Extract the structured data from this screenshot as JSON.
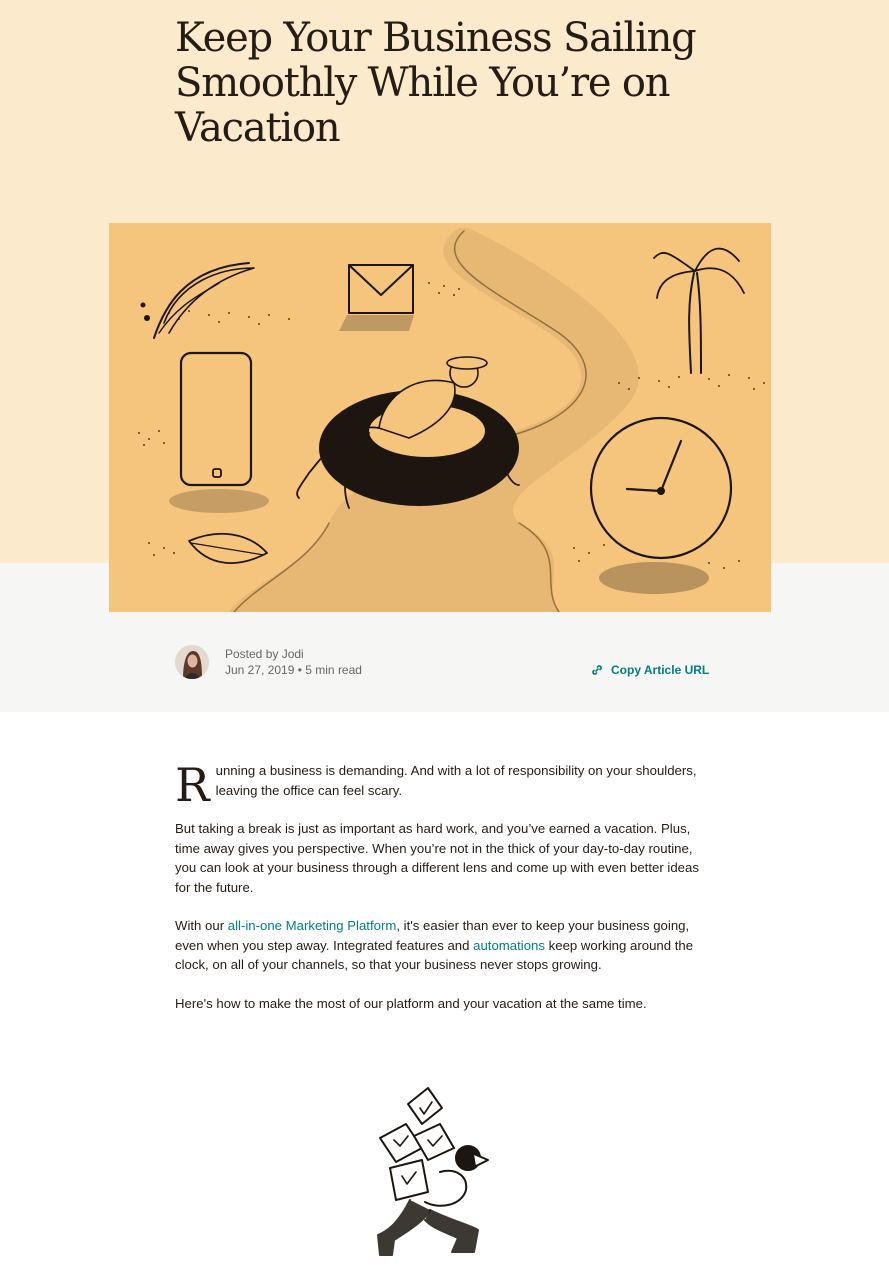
{
  "article": {
    "title": "Keep Your Business Sailing Smoothly While You’re on Vacation",
    "meta": {
      "posted_by": "Posted by Jodi",
      "date_read": "Jun 27, 2019 • 5 min read",
      "copy_url_label": "Copy Article URL",
      "link_icon": "link-icon",
      "avatar": "author-avatar"
    },
    "intro": {
      "dropcap": "R",
      "rest": "unning a business is demanding. And with a lot of responsibility on your shoulders, leaving the office can feel scary."
    },
    "p2": "But taking a break is just as important as hard work, and you’ve earned a vacation. Plus, time away gives you perspective. When you’re not in the thick of your day-to-day routine, you can look at your business through a different lens and come up with even better ideas for the future.",
    "p3": {
      "before_link1": "With our ",
      "link1": "all-in-one Marketing Platform",
      "between": ", it's easier than ever to keep your business going, even when you step away. Integrated features and ",
      "link2": "automations",
      "after": " keep working around the clock, on all of your channels, so that your business never stops growing."
    },
    "p4": "Here's how to make the most of our platform and your vacation at the same time."
  },
  "colors": {
    "hero_background": "#fbeacb",
    "illustration_background": "#f5c47d",
    "meta_band": "#f6f6f4",
    "link": "#007c89",
    "text": "#241c15"
  }
}
